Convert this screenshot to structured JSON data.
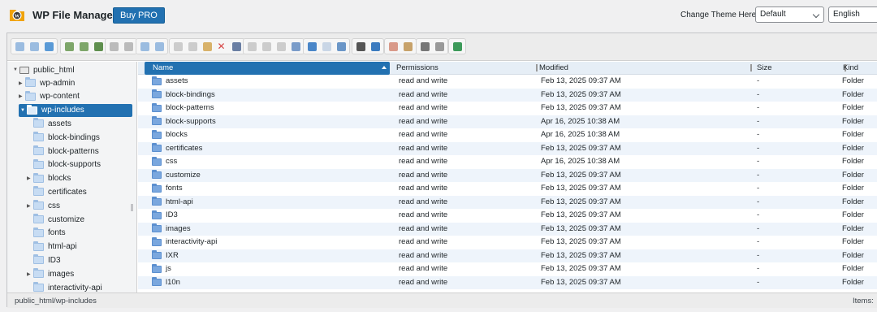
{
  "header": {
    "app_title": "WP File Manager",
    "buy_pro_label": "Buy PRO",
    "theme_label": "Change Theme Here:",
    "theme_value": "Default",
    "language_value": "English",
    "accent_color": "#2271b1"
  },
  "toolbar": {
    "buttons": [
      "back-icon",
      "forward-icon",
      "up-icon",
      "download-icon",
      "upload-icon",
      "save-icon",
      "open-icon",
      "copy-to-icon",
      "undo-icon",
      "redo-icon",
      "copy-icon",
      "cut-icon",
      "paste-icon",
      "delete-icon",
      "empty-icon",
      "duplicate-icon",
      "rename-icon",
      "edit-icon",
      "resize-icon",
      "select-all-icon",
      "select-none-icon",
      "invert-selection-icon",
      "preview-icon",
      "info-icon",
      "extract-icon",
      "archive-icon",
      "icons-view-icon",
      "list-view-icon",
      "fullscreen-icon"
    ]
  },
  "tree": {
    "root": "public_html",
    "items": [
      {
        "label": "wp-admin",
        "arrow": "▶"
      },
      {
        "label": "wp-content",
        "arrow": "▶"
      },
      {
        "label": "wp-includes",
        "arrow": "▼"
      },
      {
        "label": "assets",
        "arrow": ""
      },
      {
        "label": "block-bindings",
        "arrow": ""
      },
      {
        "label": "block-patterns",
        "arrow": ""
      },
      {
        "label": "block-supports",
        "arrow": ""
      },
      {
        "label": "blocks",
        "arrow": "▶"
      },
      {
        "label": "certificates",
        "arrow": ""
      },
      {
        "label": "css",
        "arrow": "▶"
      },
      {
        "label": "customize",
        "arrow": ""
      },
      {
        "label": "fonts",
        "arrow": ""
      },
      {
        "label": "html-api",
        "arrow": ""
      },
      {
        "label": "ID3",
        "arrow": ""
      },
      {
        "label": "images",
        "arrow": "▶"
      },
      {
        "label": "interactivity-api",
        "arrow": ""
      }
    ]
  },
  "list": {
    "columns": [
      "Name",
      "Permissions",
      "Modified",
      "Size",
      "Kind"
    ],
    "rows": [
      {
        "name": "assets",
        "perm": "read and write",
        "modified": "Feb 13, 2025 09:37 AM",
        "size": "-",
        "kind": "Folder"
      },
      {
        "name": "block-bindings",
        "perm": "read and write",
        "modified": "Feb 13, 2025 09:37 AM",
        "size": "-",
        "kind": "Folder"
      },
      {
        "name": "block-patterns",
        "perm": "read and write",
        "modified": "Feb 13, 2025 09:37 AM",
        "size": "-",
        "kind": "Folder"
      },
      {
        "name": "block-supports",
        "perm": "read and write",
        "modified": "Apr 16, 2025 10:38 AM",
        "size": "-",
        "kind": "Folder"
      },
      {
        "name": "blocks",
        "perm": "read and write",
        "modified": "Apr 16, 2025 10:38 AM",
        "size": "-",
        "kind": "Folder"
      },
      {
        "name": "certificates",
        "perm": "read and write",
        "modified": "Feb 13, 2025 09:37 AM",
        "size": "-",
        "kind": "Folder"
      },
      {
        "name": "css",
        "perm": "read and write",
        "modified": "Apr 16, 2025 10:38 AM",
        "size": "-",
        "kind": "Folder"
      },
      {
        "name": "customize",
        "perm": "read and write",
        "modified": "Feb 13, 2025 09:37 AM",
        "size": "-",
        "kind": "Folder"
      },
      {
        "name": "fonts",
        "perm": "read and write",
        "modified": "Feb 13, 2025 09:37 AM",
        "size": "-",
        "kind": "Folder"
      },
      {
        "name": "html-api",
        "perm": "read and write",
        "modified": "Feb 13, 2025 09:37 AM",
        "size": "-",
        "kind": "Folder"
      },
      {
        "name": "ID3",
        "perm": "read and write",
        "modified": "Feb 13, 2025 09:37 AM",
        "size": "-",
        "kind": "Folder"
      },
      {
        "name": "images",
        "perm": "read and write",
        "modified": "Feb 13, 2025 09:37 AM",
        "size": "-",
        "kind": "Folder"
      },
      {
        "name": "interactivity-api",
        "perm": "read and write",
        "modified": "Feb 13, 2025 09:37 AM",
        "size": "-",
        "kind": "Folder"
      },
      {
        "name": "IXR",
        "perm": "read and write",
        "modified": "Feb 13, 2025 09:37 AM",
        "size": "-",
        "kind": "Folder"
      },
      {
        "name": "js",
        "perm": "read and write",
        "modified": "Feb 13, 2025 09:37 AM",
        "size": "-",
        "kind": "Folder"
      },
      {
        "name": "l10n",
        "perm": "read and write",
        "modified": "Feb 13, 2025 09:37 AM",
        "size": "-",
        "kind": "Folder"
      }
    ]
  },
  "status": {
    "path": "public_html/wp-includes",
    "items_label": "Items:"
  }
}
